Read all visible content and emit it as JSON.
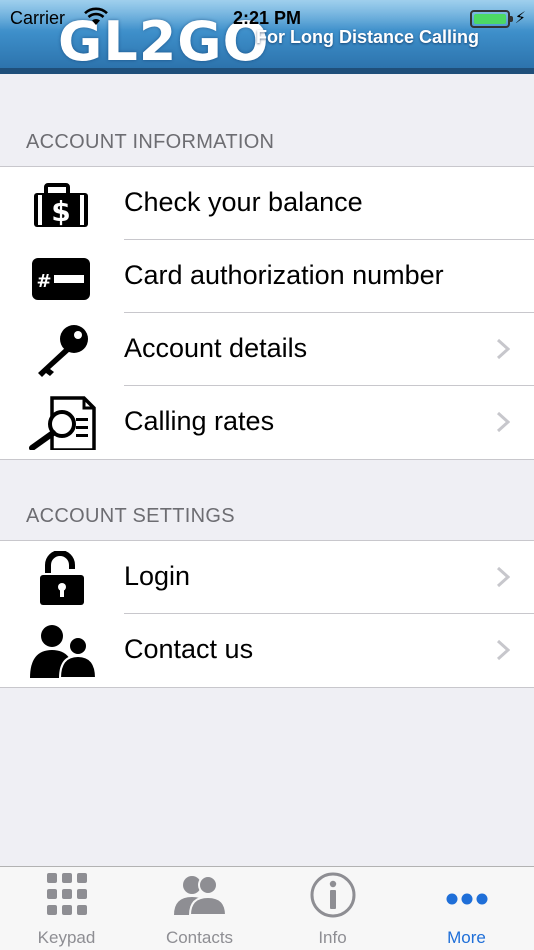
{
  "status_bar": {
    "carrier": "Carrier",
    "time": "2:21 PM"
  },
  "header": {
    "logo": "GL2GO",
    "tagline": "For Long Distance Calling"
  },
  "sections": [
    {
      "title": "ACCOUNT INFORMATION",
      "items": [
        {
          "label": "Check your balance",
          "icon": "money-bag-icon",
          "chevron": false
        },
        {
          "label": "Card authorization number",
          "icon": "card-number-icon",
          "chevron": false
        },
        {
          "label": "Account details",
          "icon": "key-icon",
          "chevron": true
        },
        {
          "label": "Calling rates",
          "icon": "magnifier-document-icon",
          "chevron": true
        }
      ]
    },
    {
      "title": "ACCOUNT SETTINGS",
      "items": [
        {
          "label": "Login",
          "icon": "unlocked-padlock-icon",
          "chevron": true
        },
        {
          "label": "Contact us",
          "icon": "people-icon",
          "chevron": true
        }
      ]
    }
  ],
  "tabs": [
    {
      "label": "Keypad",
      "icon": "keypad-icon",
      "active": false
    },
    {
      "label": "Contacts",
      "icon": "contacts-icon",
      "active": false
    },
    {
      "label": "Info",
      "icon": "info-icon",
      "active": false
    },
    {
      "label": "More",
      "icon": "more-dots-icon",
      "active": true
    }
  ],
  "colors": {
    "header_blue": "#3d8ec9",
    "active_tab": "#1f6fd8",
    "background": "#efeff4"
  }
}
